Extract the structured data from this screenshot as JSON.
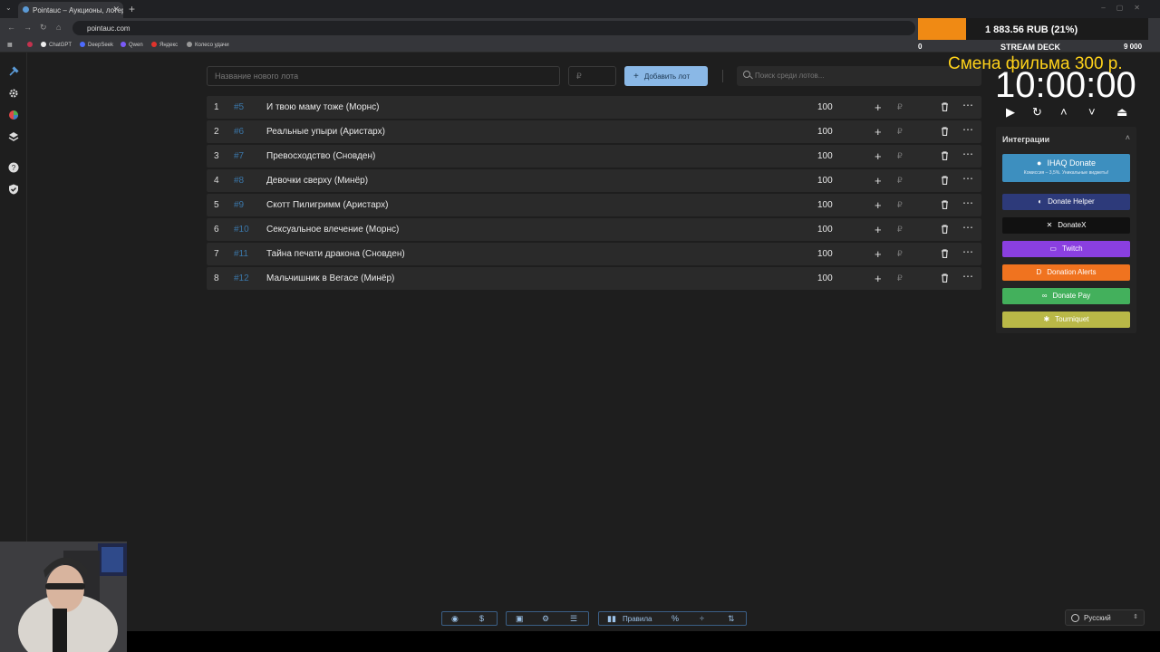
{
  "browser": {
    "tab_title": "Pointauc – Аукционы, лотерея",
    "url": "pointauc.com",
    "bookmarks": [
      "ChatGPT",
      "DeepSeek",
      "Qwen",
      "Яндекс",
      "Колесо удачи"
    ]
  },
  "toolbar": {
    "lot_placeholder": "Название нового лота",
    "price_placeholder": "₽",
    "add_label": "Добавить лот",
    "search_placeholder": "Поиск среди лотов..."
  },
  "lots": [
    {
      "num": "1",
      "id": "#5",
      "name": "И твою маму тоже (Морнс)",
      "amount": "100"
    },
    {
      "num": "2",
      "id": "#6",
      "name": "Реальные упыри (Аристарх)",
      "amount": "100"
    },
    {
      "num": "3",
      "id": "#7",
      "name": "Превосходство (Сновден)",
      "amount": "100"
    },
    {
      "num": "4",
      "id": "#8",
      "name": "Девочки сверху (Минёр)",
      "amount": "100"
    },
    {
      "num": "5",
      "id": "#9",
      "name": "Скотт Пилигримм (Аристарх)",
      "amount": "100"
    },
    {
      "num": "6",
      "id": "#10",
      "name": "Сексуальное влечение (Морнс)",
      "amount": "100"
    },
    {
      "num": "7",
      "id": "#11",
      "name": "Тайна печати дракона (Сновден)",
      "amount": "100"
    },
    {
      "num": "8",
      "id": "#12",
      "name": "Мальчишник в Вегасе (Минёр)",
      "amount": "100"
    }
  ],
  "overlay": {
    "amount": "1 883.56 RUB (21%)",
    "progress_percent": 21,
    "min": "0",
    "max": "9 000",
    "label": "STREAM DECK",
    "message": "Смена фильма 300 р.",
    "timer": "10:00:00",
    "accent": "#f08a14"
  },
  "integrations": {
    "title": "Интеграции",
    "ihaq_label": "IHAQ Donate",
    "ihaq_sub": "Комиссия – 3,5%. Уникальные виджеты!",
    "items": [
      {
        "label": "Donate Helper",
        "color": "#2d3a7a"
      },
      {
        "label": "DonateX",
        "color": "#111111"
      },
      {
        "label": "Twitch",
        "color": "#8a3fe0"
      },
      {
        "label": "Donation Alerts",
        "color": "#f0731f"
      },
      {
        "label": "Donate Pay",
        "color": "#43b05c"
      },
      {
        "label": "Tourniquet",
        "color": "#b9b847"
      }
    ]
  },
  "footer": {
    "rules_label": "Правила",
    "language": "Русский"
  }
}
